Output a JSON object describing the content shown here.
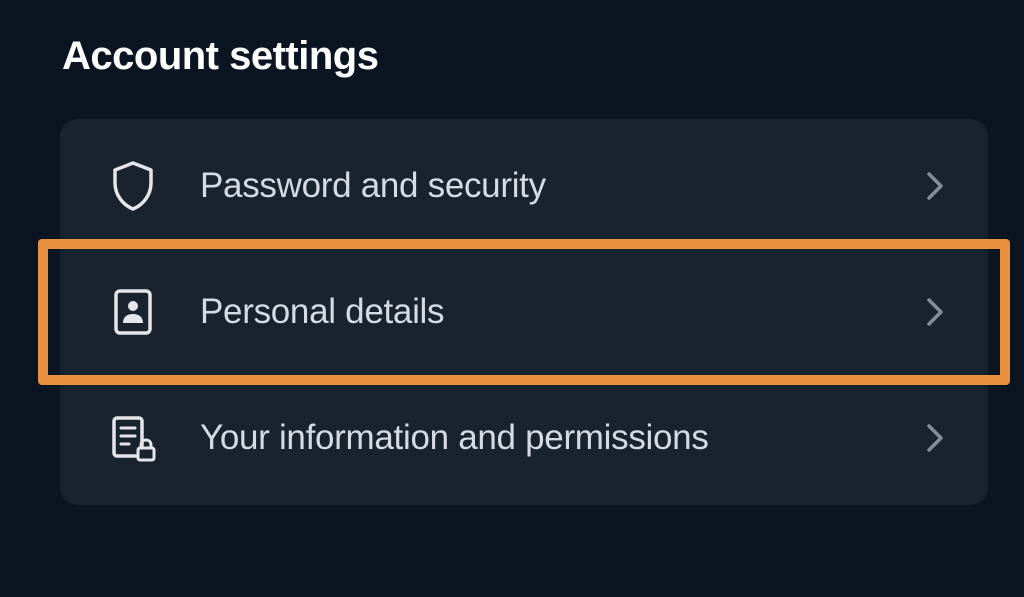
{
  "header": {
    "title": "Account settings"
  },
  "menu": {
    "items": [
      {
        "label": "Password and security",
        "highlighted": false
      },
      {
        "label": "Personal details",
        "highlighted": true
      },
      {
        "label": "Your information and permissions",
        "highlighted": false
      }
    ]
  }
}
